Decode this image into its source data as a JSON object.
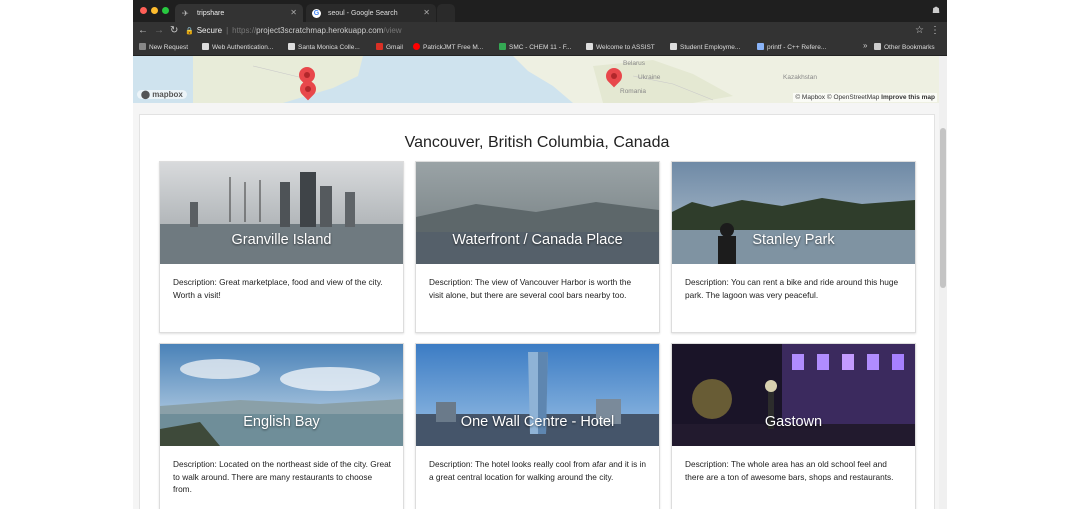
{
  "browser": {
    "tabs": [
      {
        "title": "tripshare",
        "active": true
      },
      {
        "title": "seoul - Google Search",
        "active": false
      }
    ],
    "address": {
      "secure_label": "Secure",
      "url_scheme": "https://",
      "url_host": "project3scratchmap.herokuapp.com",
      "url_path": "/view"
    },
    "bookmarks": [
      {
        "label": "New Request",
        "icon": "grid-icon",
        "color": "#888888"
      },
      {
        "label": "Web Authentication...",
        "icon": "page-icon",
        "color": "#dddddd"
      },
      {
        "label": "Santa Monica Colle...",
        "icon": "college-icon",
        "color": "#dddddd"
      },
      {
        "label": "Gmail",
        "icon": "gmail-icon",
        "color": "#d93025"
      },
      {
        "label": "PatrickJMT Free M...",
        "icon": "youtube-icon",
        "color": "#ff0000"
      },
      {
        "label": "SMC - CHEM 11 - F...",
        "icon": "sheet-icon",
        "color": "#34a853"
      },
      {
        "label": "Welcome to ASSIST",
        "icon": "assist-icon",
        "color": "#dddddd"
      },
      {
        "label": "Student Employme...",
        "icon": "student-icon",
        "color": "#dddddd"
      },
      {
        "label": "printf - C++ Refere...",
        "icon": "cpp-icon",
        "color": "#8ab4f8"
      }
    ],
    "other_bookmarks": "Other Bookmarks",
    "more_bookmarks": "»"
  },
  "map": {
    "labels": [
      "Belarus",
      "Ukraine",
      "Kazakhstan",
      "Romania"
    ],
    "logo": "mapbox",
    "attribution": {
      "mapbox": "© Mapbox",
      "osm": "© OpenStreetMap",
      "improve": "Improve this map"
    }
  },
  "page": {
    "city": "Vancouver, British Columbia, Canada",
    "places": [
      {
        "name": "Granville Island",
        "description": "Description: Great marketplace, food and view of the city. Worth a visit!"
      },
      {
        "name": "Waterfront / Canada Place",
        "description": "Description: The view of Vancouver Harbor is worth the visit alone, but there are several cool bars nearby too."
      },
      {
        "name": "Stanley Park",
        "description": "Description: You can rent a bike and ride around this huge park. The lagoon was very peaceful."
      },
      {
        "name": "English Bay",
        "description": "Description: Located on the northeast side of the city. Great to walk around. There are many restaurants to choose from."
      },
      {
        "name": "One Wall Centre - Hotel",
        "description": "Description: The hotel looks really cool from afar and it is in a great central location for walking around the city."
      },
      {
        "name": "Gastown",
        "description": "Description: The whole area has an old school feel and there are a ton of awesome bars, shops and restaurants."
      }
    ]
  }
}
